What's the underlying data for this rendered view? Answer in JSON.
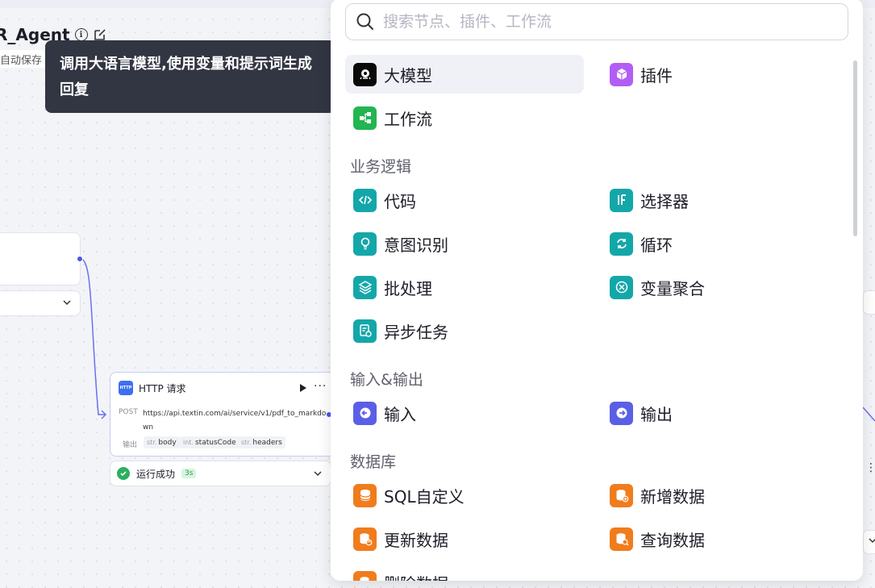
{
  "canvas": {
    "app_title": "R_Agent",
    "autosave": "自动保存"
  },
  "tooltip": {
    "text": "调用大语言模型,使用变量和提示词生成回复"
  },
  "http_node": {
    "badge": "HTTP",
    "title": "HTTP 请求",
    "method": "POST",
    "url": "https://api.textin.com/ai/service/v1/pdf_to_markdown",
    "output_label": "输出",
    "outputs": [
      {
        "type": "str.",
        "name": "body"
      },
      {
        "type": "int.",
        "name": "statusCode"
      },
      {
        "type": "str.",
        "name": "headers"
      }
    ],
    "status": "运行成功",
    "duration": "3s"
  },
  "panel": {
    "search_placeholder": "搜索节点、插件、工作流",
    "top_items": [
      {
        "label": "大模型",
        "icon": "llm-icon",
        "color": "#0a0a0a"
      },
      {
        "label": "插件",
        "icon": "plugin-cube-icon",
        "color": "#b25ef5"
      },
      {
        "label": "工作流",
        "icon": "workflow-icon",
        "color": "#22b551"
      }
    ],
    "sections": [
      {
        "title": "业务逻辑",
        "items": [
          {
            "label": "代码",
            "icon": "code-icon",
            "color": "#14a7a9"
          },
          {
            "label": "选择器",
            "icon": "if-selector-icon",
            "color": "#14a7a9"
          },
          {
            "label": "意图识别",
            "icon": "intent-bulb-icon",
            "color": "#14a7a9"
          },
          {
            "label": "循环",
            "icon": "loop-icon",
            "color": "#14a7a9"
          },
          {
            "label": "批处理",
            "icon": "batch-layers-icon",
            "color": "#14a7a9"
          },
          {
            "label": "变量聚合",
            "icon": "variable-merge-icon",
            "color": "#14a7a9"
          },
          {
            "label": "异步任务",
            "icon": "async-task-icon",
            "color": "#14a7a9"
          }
        ]
      },
      {
        "title": "输入&输出",
        "items": [
          {
            "label": "输入",
            "icon": "input-icon",
            "color": "#5b5fe6"
          },
          {
            "label": "输出",
            "icon": "output-icon",
            "color": "#5b5fe6"
          }
        ]
      },
      {
        "title": "数据库",
        "items": [
          {
            "label": "SQL自定义",
            "icon": "database-sql-icon",
            "color": "#f07c1c"
          },
          {
            "label": "新增数据",
            "icon": "database-add-icon",
            "color": "#f07c1c"
          },
          {
            "label": "更新数据",
            "icon": "database-update-icon",
            "color": "#f07c1c"
          },
          {
            "label": "查询数据",
            "icon": "database-query-icon",
            "color": "#f07c1c"
          },
          {
            "label": "删除数据",
            "icon": "database-delete-icon",
            "color": "#f07c1c"
          }
        ]
      }
    ]
  }
}
